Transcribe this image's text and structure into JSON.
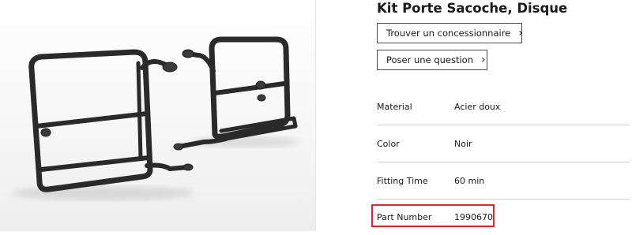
{
  "product": {
    "title": "Kit Porte Sacoche, Disque",
    "image_alt": "pannier-rack-frames"
  },
  "actions": {
    "find_dealer_label": "Trouver un concessionnaire",
    "ask_question_label": "Poser une question",
    "chevron": "›"
  },
  "specs": [
    {
      "label": "Material",
      "value": "Acier doux"
    },
    {
      "label": "Color",
      "value": "Noir"
    },
    {
      "label": "Fitting Time",
      "value": "60 min"
    },
    {
      "label": "Part Number",
      "value": "1990670"
    }
  ],
  "colors": {
    "frame": "#2a2a2a",
    "highlight": "#d9262f"
  }
}
